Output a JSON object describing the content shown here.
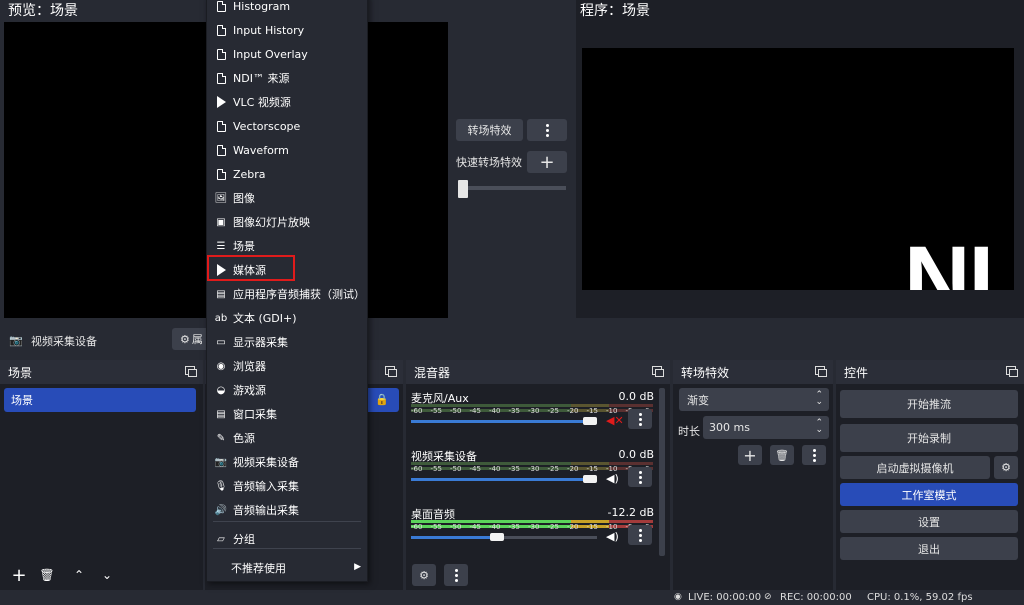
{
  "preview": {
    "title": "预览：场景"
  },
  "program": {
    "title": "程序：场景",
    "logo_text": "NI"
  },
  "transition_panel": {
    "transition_button": "转场特效",
    "quick_transition_label": "快速转场特效",
    "add_icon": "plus-icon",
    "more_icon": "dots-vertical-icon"
  },
  "source_toolbar": {
    "label": "视频采集设备",
    "properties_label": "属"
  },
  "context_menu": {
    "items": [
      {
        "label": "Histogram",
        "icon": "file-icon"
      },
      {
        "label": "Input History",
        "icon": "file-icon"
      },
      {
        "label": "Input Overlay",
        "icon": "file-icon"
      },
      {
        "label": "NDI™ 来源",
        "icon": "file-icon"
      },
      {
        "label": "VLC 视频源",
        "icon": "play-icon"
      },
      {
        "label": "Vectorscope",
        "icon": "file-icon"
      },
      {
        "label": "Waveform",
        "icon": "file-icon"
      },
      {
        "label": "Zebra",
        "icon": "file-icon"
      },
      {
        "label": "图像",
        "icon": "image-icon"
      },
      {
        "label": "图像幻灯片放映",
        "icon": "slideshow-icon"
      },
      {
        "label": "场景",
        "icon": "list-icon"
      },
      {
        "label": "媒体源",
        "icon": "play-icon"
      },
      {
        "label": "应用程序音频捕获（测试）",
        "icon": "app-audio-icon"
      },
      {
        "label": "文本 (GDI+)",
        "icon": "text-icon"
      },
      {
        "label": "显示器采集",
        "icon": "monitor-icon"
      },
      {
        "label": "浏览器",
        "icon": "globe-icon"
      },
      {
        "label": "游戏源",
        "icon": "gamepad-icon"
      },
      {
        "label": "窗口采集",
        "icon": "window-icon"
      },
      {
        "label": "色源",
        "icon": "brush-icon"
      },
      {
        "label": "视频采集设备",
        "icon": "camera-icon"
      },
      {
        "label": "音频输入采集",
        "icon": "microphone-icon"
      },
      {
        "label": "音频输出采集",
        "icon": "speaker-icon"
      },
      {
        "label": "分组",
        "icon": "folder-icon"
      },
      {
        "label": "不推荐使用",
        "icon": "chevron-right-icon"
      }
    ]
  },
  "scenes_dock": {
    "title": "场景",
    "items": [
      "场景"
    ]
  },
  "mixer": {
    "title": "混音器",
    "scale_ticks": [
      "-60",
      "-55",
      "-50",
      "-45",
      "-40",
      "-35",
      "-30",
      "-25",
      "-20",
      "-15",
      "-10",
      "-5",
      "0"
    ],
    "channels": [
      {
        "name": "麦克风/Aux",
        "db": "0.0 dB",
        "volume": 1.0,
        "muted": true
      },
      {
        "name": "视频采集设备",
        "db": "0.0 dB",
        "volume": 1.0,
        "muted": false
      },
      {
        "name": "桌面音频",
        "db": "-12.2 dB",
        "volume": 0.5,
        "muted": false
      }
    ]
  },
  "transitions_dock": {
    "title": "转场特效",
    "selected": "渐变",
    "duration_label": "时长",
    "duration_value": "300 ms"
  },
  "controls_dock": {
    "title": "控件",
    "buttons": {
      "start_stream": "开始推流",
      "start_record": "开始录制",
      "virtual_cam": "启动虚拟摄像机",
      "studio_mode": "工作室模式",
      "settings": "设置",
      "exit": "退出"
    }
  },
  "status": {
    "live": "LIVE: 00:00:00",
    "rec": "REC: 00:00:00",
    "cpu": "CPU: 0.1%, 59.02 fps"
  },
  "colors": {
    "accent": "#284cb8",
    "highlight": "#e01b1b",
    "meter_green": "#4caf50",
    "meter_yellow": "#c9a227",
    "meter_red": "#a33b3b"
  }
}
